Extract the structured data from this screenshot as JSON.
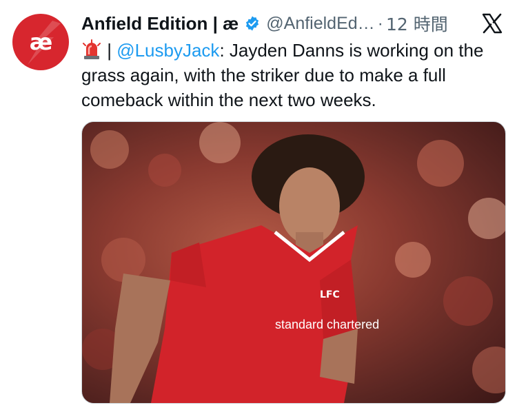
{
  "account": {
    "display_name": "Anfield Edition | æ",
    "handle": "@AnfieldEd…",
    "separator": "·",
    "timestamp": "12 時間",
    "avatar_letters": "æ",
    "verified": true
  },
  "tweet": {
    "emoji": "siren-icon",
    "pipe": " | ",
    "mention": "@LusbyJack",
    "text": ": Jayden Danns is working on the grass again, with the striker due to make a full comeback within the next two weeks."
  },
  "media": {
    "description_icon": "photo",
    "kit_sponsor": "standard chartered",
    "badge": "LFC"
  },
  "colors": {
    "brand_red": "#d7262e",
    "verified_blue": "#1d9bf0",
    "mention_blue": "#1d9bf0",
    "muted": "#536471"
  }
}
